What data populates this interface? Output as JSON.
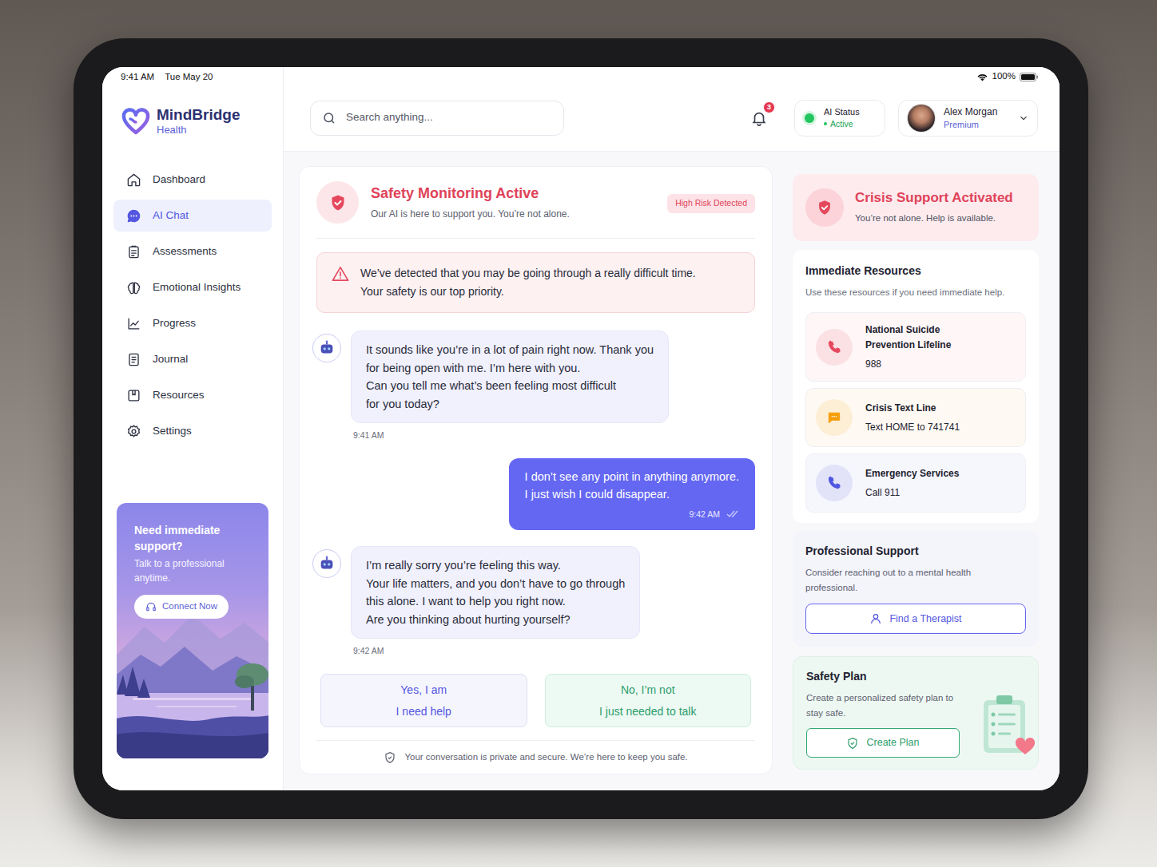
{
  "status_bar": {
    "time": "9:41 AM",
    "date": "Tue May 20",
    "battery": "100%"
  },
  "app": {
    "name": "MindBridge",
    "subtitle": "Health"
  },
  "sidebar": {
    "items": [
      {
        "label": "Dashboard",
        "selected": false
      },
      {
        "label": "AI Chat",
        "selected": true
      },
      {
        "label": "Assessments",
        "selected": false
      },
      {
        "label": "Emotional Insights",
        "selected": false
      },
      {
        "label": "Progress",
        "selected": false
      },
      {
        "label": "Journal",
        "selected": false
      },
      {
        "label": "Resources",
        "selected": false
      },
      {
        "label": "Settings",
        "selected": false
      }
    ],
    "support_card": {
      "title": "Need immediate support?",
      "text": "Talk to a professional anytime.",
      "button": "Connect Now"
    }
  },
  "search": {
    "placeholder": "Search anything..."
  },
  "notifications": {
    "count": "3"
  },
  "ai_status": {
    "label": "AI Status",
    "value": "Active",
    "active": true
  },
  "user": {
    "name": "Alex Morgan",
    "plan": "Premium"
  },
  "chat": {
    "title": "Safety Monitoring Active",
    "subtitle": "Our AI is here to support you. You’re not alone.",
    "badge": "High Risk Detected",
    "alert": {
      "lines": [
        "We’ve detected that you may be going through a really difficult time.",
        "Your safety is our top priority."
      ]
    },
    "messages": [
      {
        "kind": "bot",
        "lines": [
          "It sounds like you’re in a lot of pain right now. Thank you",
          "for being open with me. I’m here with you.",
          "Can you tell me what’s been feeling most difficult",
          "for you today?"
        ],
        "time": "9:41 AM"
      },
      {
        "kind": "user",
        "lines": [
          "I don’t see any point in anything anymore.",
          "I just wish I could disappear."
        ],
        "time": "9:42 AM",
        "read": true
      },
      {
        "kind": "bot",
        "lines": [
          "I’m really sorry you’re feeling this way.",
          "Your life matters, and you don’t have to go through",
          "this alone. I want to help you right now.",
          "Are you thinking about hurting yourself?"
        ],
        "time": "9:42 AM"
      }
    ],
    "quick_replies": [
      {
        "kind": "help",
        "title": "Yes, I am",
        "text": "I need help"
      },
      {
        "kind": "talk",
        "title": "No, I’m not",
        "text": "I just needed to talk"
      }
    ],
    "footer": "Your conversation is private and secure. We’re here to keep you safe."
  },
  "crisis": {
    "title": "Crisis Support Activated",
    "subtitle": "You’re not alone. Help is available."
  },
  "resources": {
    "title": "Immediate Resources",
    "subtitle": "Use these resources if you need immediate help.",
    "items": [
      {
        "kind": "phone",
        "name_lines": [
          "National Suicide",
          "Prevention Lifeline"
        ],
        "detail": "988",
        "color": "#e5485d"
      },
      {
        "kind": "text",
        "name_lines": [
          "Crisis Text Line"
        ],
        "detail": "Text HOME to 741741",
        "color": "#f59e0b"
      },
      {
        "kind": "phone",
        "name_lines": [
          "Emergency Services"
        ],
        "detail": "Call 911",
        "color": "#4f56e0"
      }
    ]
  },
  "professional": {
    "title": "Professional Support",
    "text": "Consider reaching out to a mental health professional.",
    "button": "Find a Therapist"
  },
  "safety_plan": {
    "title": "Safety Plan",
    "text": "Create a personalized safety plan to stay safe.",
    "button": "Create Plan"
  }
}
